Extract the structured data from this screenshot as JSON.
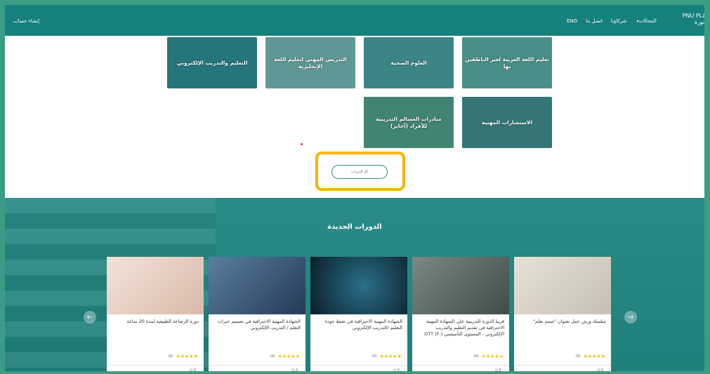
{
  "nav": {
    "logo_line1": "PNU PLAT",
    "logo_line2": "ة نورة",
    "links": [
      "المجالات",
      "شركاؤنا",
      "اتصل بنا",
      "ENG"
    ],
    "create_account": "إنشاء حساب"
  },
  "tiles": [
    {
      "label": "تعليم اللغة العربية لغير الناطقين بها",
      "color": "#8bb9a9"
    },
    {
      "label": "العلوم الصحية",
      "color": "#6aa3a0"
    },
    {
      "label": "التدريس المهني لتعليم اللغة الإنجليزية",
      "color": "#b9c9c4"
    },
    {
      "label": "التعليم والتدريب الإلكتروني",
      "color": "#3b7e8c"
    },
    {
      "label": "الاستشارات المهنية",
      "color": "#5d7f80"
    },
    {
      "label": "مبادرات العسالم التدريبية للأفراد (آخاير)",
      "color": "#7aa079"
    }
  ],
  "all_courses_label": "كل الدورات",
  "new_courses": {
    "title": "الدورات الجديدة",
    "cards": [
      {
        "title": "سلسلة ورش عمل بعنوان \"صمم بعلم\"",
        "rating_count": "(0)",
        "img_color": "#d9d2c8"
      },
      {
        "title": "قريبا الدورة التدريبية على الشهادة المهنية الاحترافية في تقديم التعليم والتدريب الإلكتروني - المستوى التأسيسي (-OTT (F",
        "rating_count": "(0)",
        "img_color": "#5c6a68"
      },
      {
        "title": "الشهادة المهنية الاحترافية في ضبط جودة التعليم /التدريب الإلكتروني",
        "rating_count": "(0)",
        "img_color": "#0f2c38"
      },
      {
        "title": "الشهادة المهنية الاحترافية في تصميم خبرات التعلم / التدريب الإلكتروني",
        "rating_count": "(0)",
        "img_color": "#3a5a78"
      },
      {
        "title": "دورة الرضاعة الطبيعية لمدة 20 ساعة",
        "rating_count": "(0)",
        "img_color": "#e8d2c8"
      }
    ],
    "stars": "★★★★★"
  },
  "meta_icons": "⊡ 8"
}
